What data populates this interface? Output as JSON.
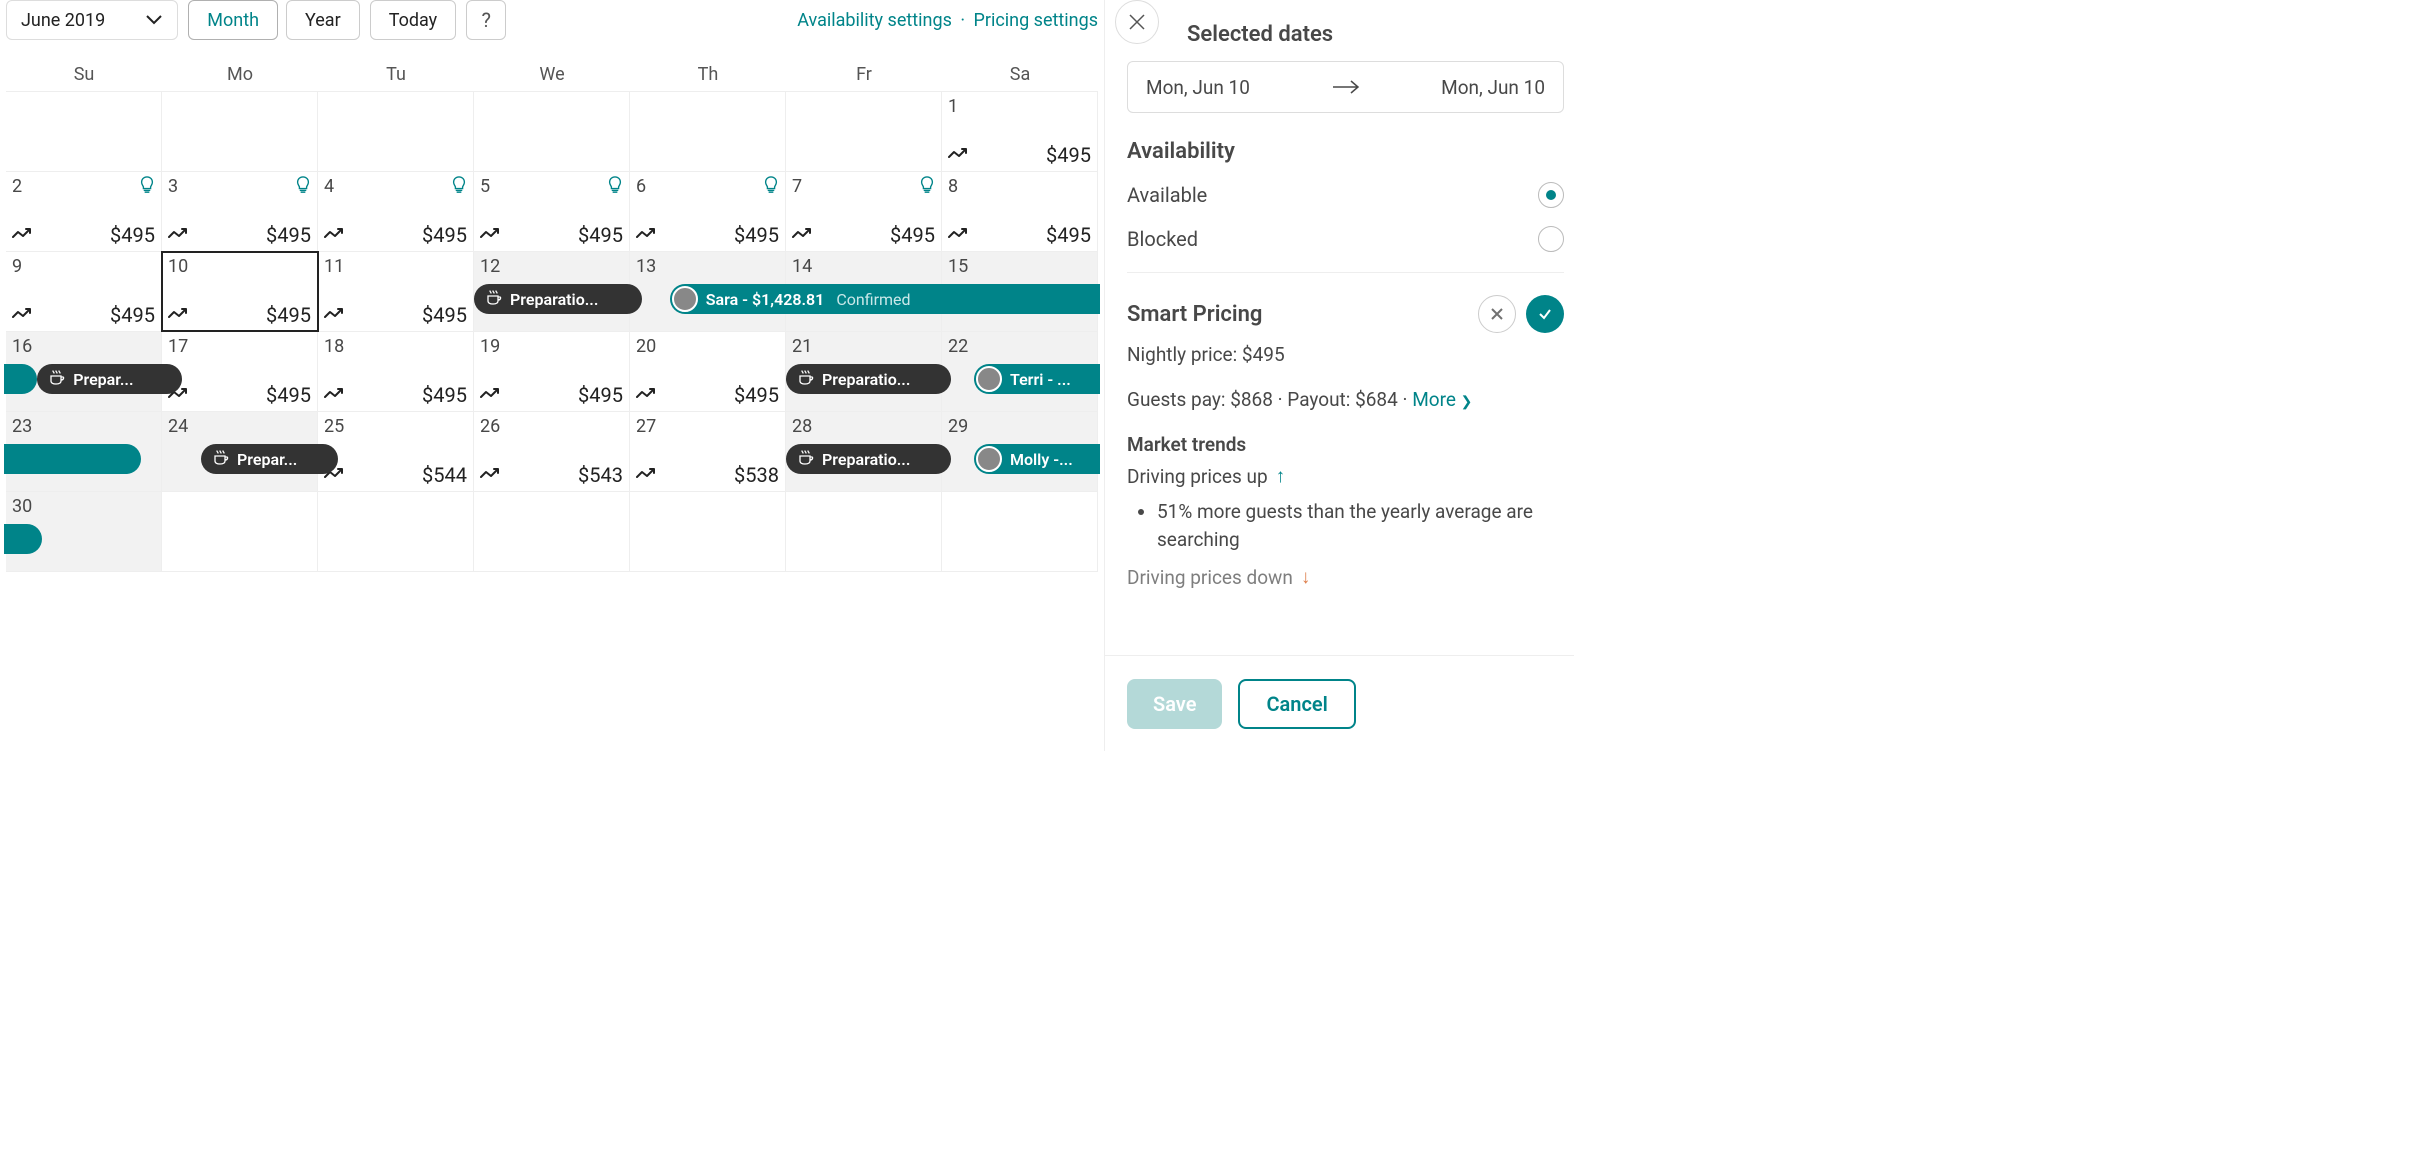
{
  "toolbar": {
    "month_label": "June 2019",
    "view_month": "Month",
    "view_year": "Year",
    "today": "Today",
    "help": "?",
    "availability_link": "Availability settings",
    "pricing_link": "Pricing settings"
  },
  "dow": [
    "Su",
    "Mo",
    "Tu",
    "We",
    "Th",
    "Fr",
    "Sa"
  ],
  "weeks": [
    [
      {
        "blank": true
      },
      {
        "blank": true
      },
      {
        "blank": true
      },
      {
        "blank": true
      },
      {
        "blank": true
      },
      {
        "blank": true
      },
      {
        "day": "1",
        "price": "$495",
        "trend": true
      }
    ],
    [
      {
        "day": "2",
        "price": "$495",
        "trend": true,
        "bulb": true
      },
      {
        "day": "3",
        "price": "$495",
        "trend": true,
        "bulb": true
      },
      {
        "day": "4",
        "price": "$495",
        "trend": true,
        "bulb": true
      },
      {
        "day": "5",
        "price": "$495",
        "trend": true,
        "bulb": true
      },
      {
        "day": "6",
        "price": "$495",
        "trend": true,
        "bulb": true
      },
      {
        "day": "7",
        "price": "$495",
        "trend": true,
        "bulb": true
      },
      {
        "day": "8",
        "price": "$495",
        "trend": true
      }
    ],
    [
      {
        "day": "9",
        "price": "$495",
        "trend": true
      },
      {
        "day": "10",
        "price": "$495",
        "trend": true,
        "selected": true
      },
      {
        "day": "11",
        "price": "$495",
        "trend": true
      },
      {
        "day": "12",
        "grey": true
      },
      {
        "day": "13",
        "grey": true
      },
      {
        "day": "14",
        "grey": true
      },
      {
        "day": "15",
        "grey": true
      }
    ],
    [
      {
        "day": "16",
        "grey": true
      },
      {
        "day": "17",
        "price": "$495",
        "trend": true
      },
      {
        "day": "18",
        "price": "$495",
        "trend": true
      },
      {
        "day": "19",
        "price": "$495",
        "trend": true
      },
      {
        "day": "20",
        "price": "$495",
        "trend": true
      },
      {
        "day": "21",
        "grey": true
      },
      {
        "day": "22",
        "grey": true
      }
    ],
    [
      {
        "day": "23",
        "grey": true
      },
      {
        "day": "24",
        "grey": true
      },
      {
        "day": "25",
        "price": "$544",
        "trend": true
      },
      {
        "day": "26",
        "price": "$543",
        "trend": true
      },
      {
        "day": "27",
        "price": "$538",
        "trend": true
      },
      {
        "day": "28",
        "grey": true
      },
      {
        "day": "29",
        "grey": true
      }
    ],
    [
      {
        "day": "30",
        "grey": true
      },
      {
        "blank": true
      },
      {
        "blank": true
      },
      {
        "blank": true
      },
      {
        "blank": true
      },
      {
        "blank": true
      },
      {
        "blank": true
      }
    ]
  ],
  "events": {
    "w2_prep": "Preparatio...",
    "w2_book_name": "Sara - $1,428.81",
    "w2_book_status": "Confirmed",
    "w3_prep": "Prepar...",
    "w3_prep2": "Preparatio...",
    "w3_book_name": "Terri - ...",
    "w4_prep": "Prepar...",
    "w4_prep2": "Preparatio...",
    "w4_book_name": "Molly -..."
  },
  "panel": {
    "selected_dates_title": "Selected dates",
    "date_from": "Mon, Jun 10",
    "date_to": "Mon, Jun 10",
    "availability_title": "Availability",
    "available_label": "Available",
    "blocked_label": "Blocked",
    "smart_pricing_title": "Smart Pricing",
    "nightly_price": "Nightly price: $495",
    "guests_pay": "Guests pay: $868 · Payout: $684 · ",
    "more": "More",
    "market_trends_title": "Market trends",
    "driving_up": "Driving prices up",
    "bullet1": "51% more guests than the yearly average are searching",
    "driving_down": "Driving prices down",
    "save": "Save",
    "cancel": "Cancel"
  }
}
